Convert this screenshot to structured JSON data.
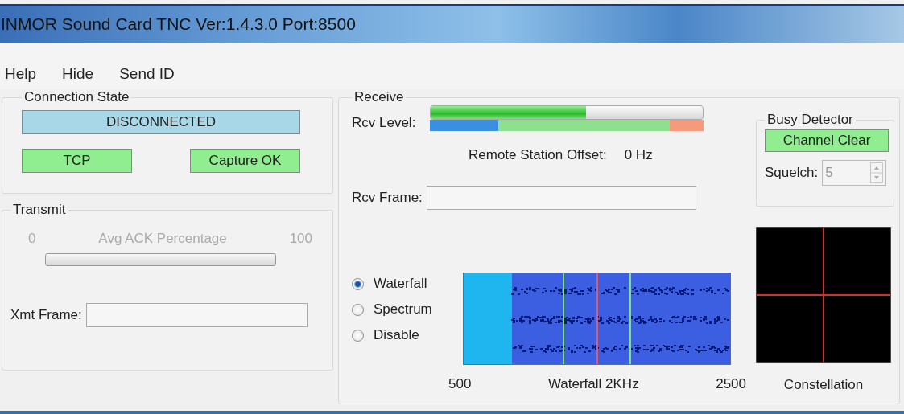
{
  "window": {
    "title": "INMOR Sound Card TNC Ver:1.4.3.0 Port:8500"
  },
  "menu": [
    "Help",
    "Hide",
    "Send ID"
  ],
  "connection_state": {
    "title": "Connection State",
    "status": "DISCONNECTED",
    "transport": "TCP",
    "capture": "Capture OK"
  },
  "transmit": {
    "title": "Transmit",
    "min_label": "0",
    "meter_label": "Avg ACK Percentage",
    "max_label": "100",
    "level": 0,
    "xmt_frame_label": "Xmt Frame:"
  },
  "receive": {
    "title": "Receive",
    "rcv_level_label": "Rcv Level:",
    "level": 0.57,
    "offset_label": "Remote Station Offset:",
    "offset_value": "0 Hz",
    "rcv_frame_label": "Rcv Frame:",
    "display_modes": [
      {
        "label": "Waterfall",
        "selected": true
      },
      {
        "label": "Spectrum",
        "selected": false
      },
      {
        "label": "Disable",
        "selected": false
      }
    ],
    "scale_min": "500",
    "scale_title": "Waterfall 2KHz",
    "scale_max": "2500",
    "constellation_label": "Constellation"
  },
  "busy_detector": {
    "title": "Busy Detector",
    "status": "Channel Clear",
    "squelch_label": "Squelch:",
    "squelch_value": "5"
  }
}
